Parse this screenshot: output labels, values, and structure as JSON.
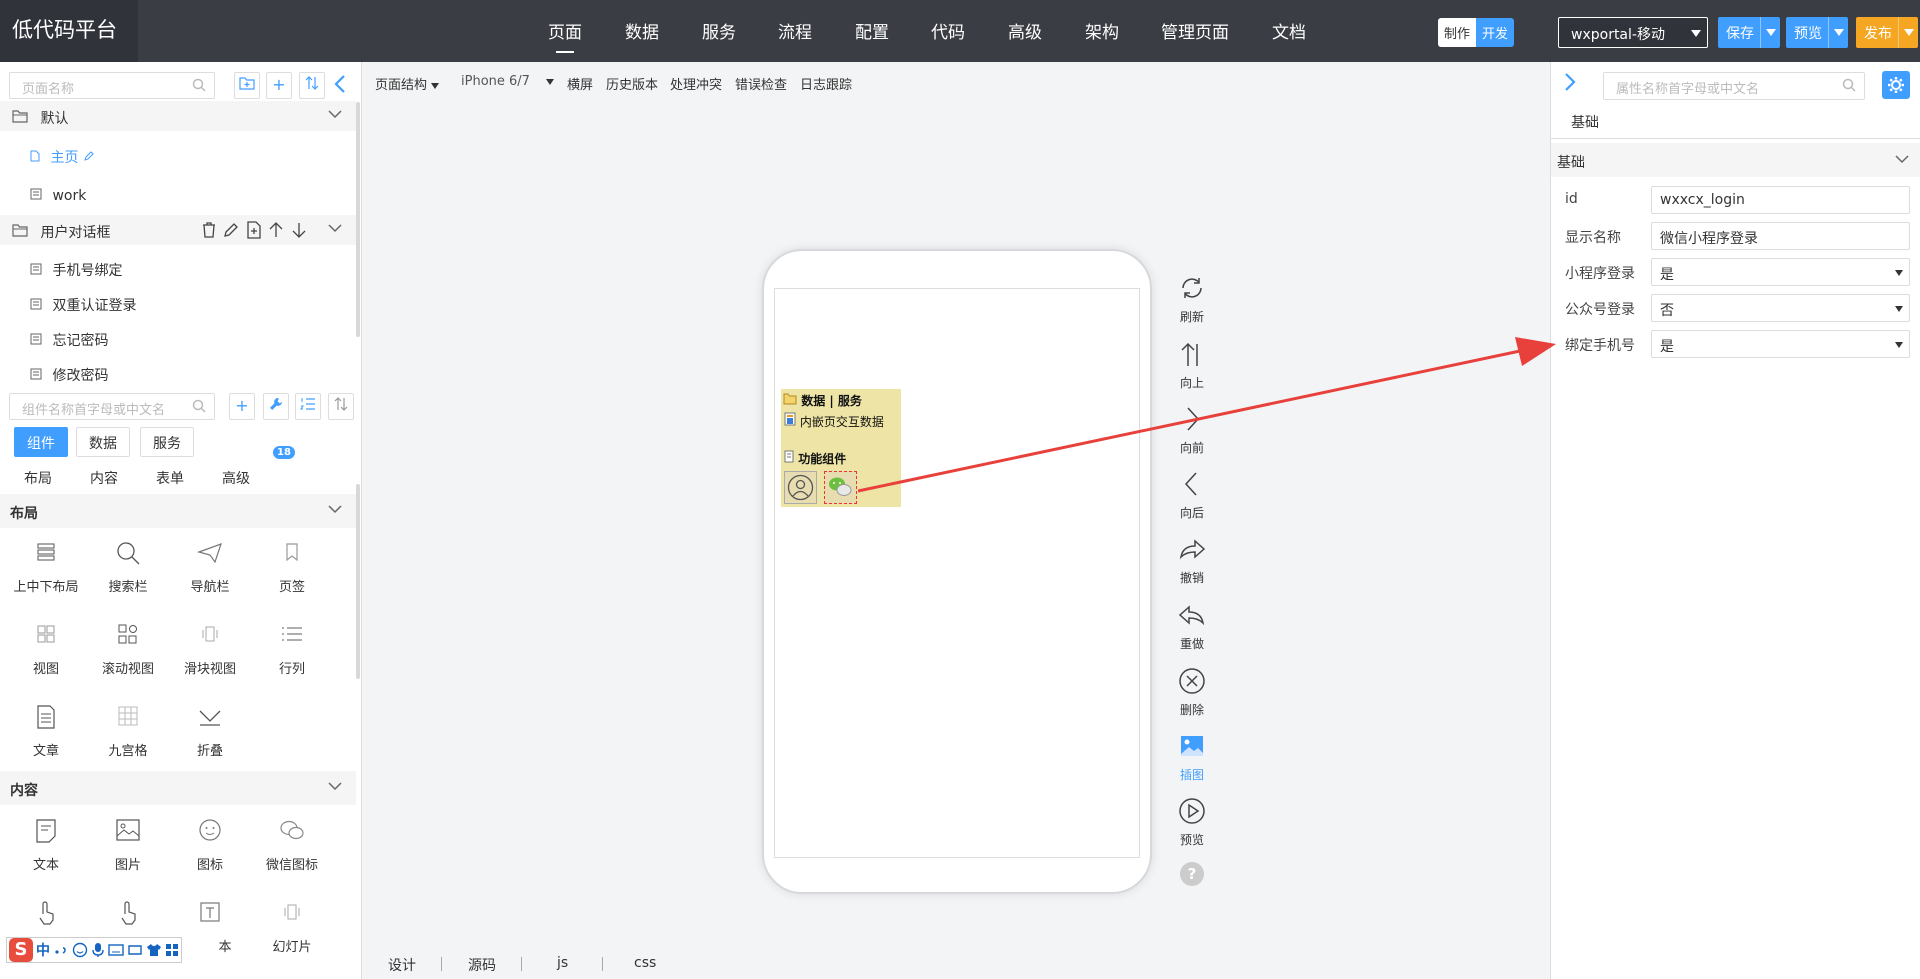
{
  "app_title": "低代码平台",
  "nav": [
    "页面",
    "数据",
    "服务",
    "流程",
    "配置",
    "代码",
    "高级",
    "架构",
    "管理页面",
    "文档"
  ],
  "mode": {
    "make": "制作",
    "dev": "开发"
  },
  "app_select": "wxportal-移动",
  "buttons": {
    "save": "保存",
    "preview": "预览",
    "publish": "发布"
  },
  "colors": {
    "accent": "#409eff",
    "publish": "#f5a623",
    "topbar": "#3a3d43",
    "arrow": "#e8413c"
  },
  "left": {
    "page_search_placeholder": "页面名称",
    "groups": [
      {
        "name": "默认",
        "items": [
          "主页",
          "work"
        ]
      },
      {
        "name": "用户对话框",
        "items": [
          "手机号绑定",
          "双重认证登录",
          "忘记密码",
          "修改密码"
        ]
      }
    ],
    "component_search_placeholder": "组件名称首字母或中文名",
    "badge": "18",
    "tabs": [
      "组件",
      "数据",
      "服务"
    ],
    "subtabs": [
      "布局",
      "内容",
      "表单",
      "高级"
    ],
    "sections": [
      {
        "name": "布局",
        "items": [
          "上中下布局",
          "搜索栏",
          "导航栏",
          "页签",
          "视图",
          "滚动视图",
          "滑块视图",
          "行列",
          "文章",
          "九宫格",
          "折叠"
        ]
      },
      {
        "name": "内容",
        "items": [
          "文本",
          "图片",
          "图标",
          "微信图标",
          "",
          "",
          "本",
          "幻灯片"
        ]
      }
    ],
    "ime": {
      "zh": "中"
    }
  },
  "center": {
    "toolbar": [
      "页面结构",
      "iPhone 6/7",
      "横屏",
      "历史版本",
      "处理冲突",
      "错误检查",
      "日志跟踪"
    ],
    "component_box": {
      "title": "数据 | 服务",
      "item": "内嵌页交互数据",
      "group": "功能组件"
    },
    "side_actions": [
      "刷新",
      "向上",
      "向前",
      "向后",
      "撤销",
      "重做",
      "删除",
      "插图",
      "预览"
    ],
    "help": "?",
    "bottom_tabs": [
      "设计",
      "源码",
      "js",
      "css"
    ]
  },
  "right": {
    "search_placeholder": "属性名称首字母或中文名",
    "tab": "基础",
    "section": "基础",
    "props": [
      {
        "label": "id",
        "value": "wxxcx_login",
        "type": "text"
      },
      {
        "label": "显示名称",
        "value": "微信小程序登录",
        "type": "text"
      },
      {
        "label": "小程序登录",
        "value": "是",
        "type": "select"
      },
      {
        "label": "公众号登录",
        "value": "否",
        "type": "select"
      },
      {
        "label": "绑定手机号",
        "value": "是",
        "type": "select"
      }
    ]
  }
}
